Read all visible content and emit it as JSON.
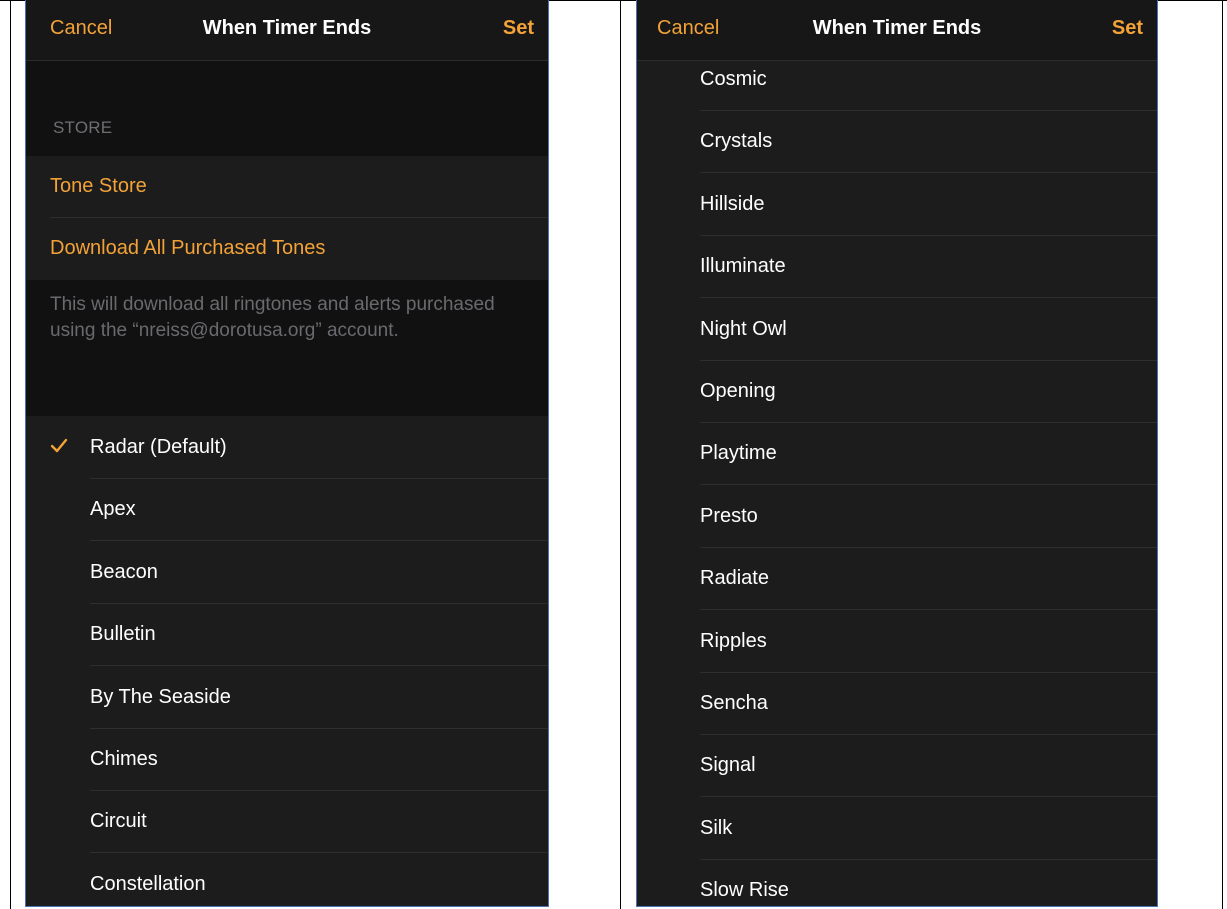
{
  "nav": {
    "cancel_label": "Cancel",
    "title": "When Timer Ends",
    "set_label": "Set"
  },
  "store": {
    "section_header": "STORE",
    "tone_store_label": "Tone Store",
    "download_label": "Download All Purchased Tones",
    "footer": "This will download all ringtones and alerts purchased using the “nreiss@dorotusa.org” account."
  },
  "left_tones": [
    {
      "label": "Radar (Default)",
      "selected": true
    },
    {
      "label": "Apex"
    },
    {
      "label": "Beacon"
    },
    {
      "label": "Bulletin"
    },
    {
      "label": "By The Seaside"
    },
    {
      "label": "Chimes"
    },
    {
      "label": "Circuit"
    },
    {
      "label": "Constellation"
    }
  ],
  "right_tones": [
    {
      "label": "Cosmic"
    },
    {
      "label": "Crystals"
    },
    {
      "label": "Hillside"
    },
    {
      "label": "Illuminate"
    },
    {
      "label": "Night Owl"
    },
    {
      "label": "Opening"
    },
    {
      "label": "Playtime"
    },
    {
      "label": "Presto"
    },
    {
      "label": "Radiate"
    },
    {
      "label": "Ripples"
    },
    {
      "label": "Sencha"
    },
    {
      "label": "Signal"
    },
    {
      "label": "Silk"
    },
    {
      "label": "Slow Rise"
    }
  ],
  "colors": {
    "accent": "#f3a237",
    "background": "#1c1c1c",
    "text": "#ffffff"
  },
  "icons": {
    "selected": "checkmark-icon"
  }
}
